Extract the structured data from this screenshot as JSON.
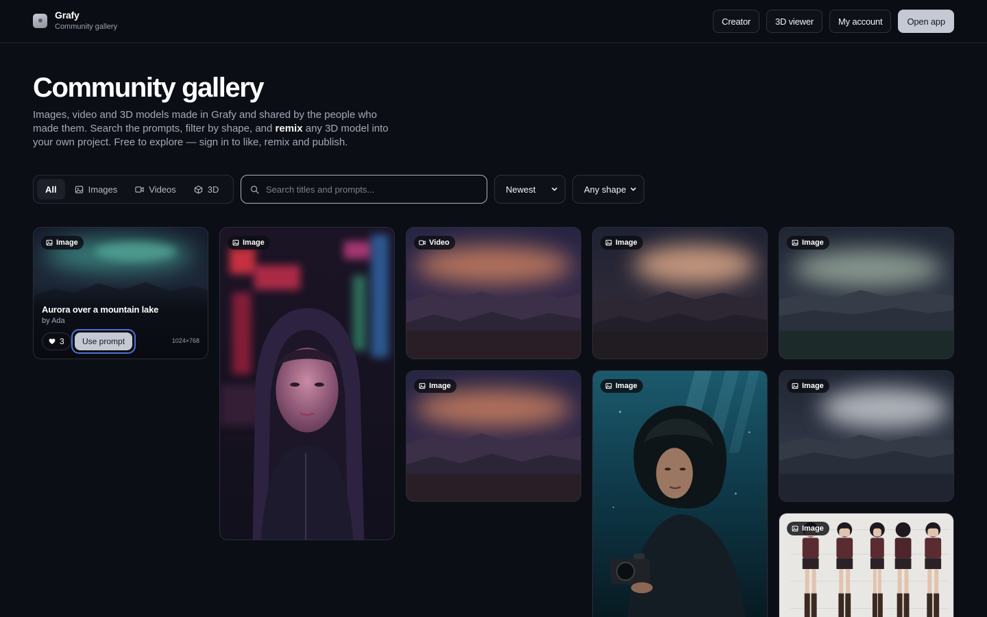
{
  "header": {
    "brand_name": "Grafy",
    "brand_sub": "Community gallery",
    "nav": [
      {
        "label": "Creator"
      },
      {
        "label": "3D viewer"
      },
      {
        "label": "My account"
      },
      {
        "label": "Open app"
      }
    ]
  },
  "hero": {
    "title": "Community gallery",
    "desc_part1": "Images, video and 3D models made in Grafy and shared by the people who made them. Search the prompts, filter by shape, and ",
    "desc_bold": "remix",
    "desc_part2": " any 3D model into your own project. Free to explore — sign in to like, remix and publish."
  },
  "filters": {
    "tabs": [
      {
        "label": "All",
        "icon": "none",
        "active": true
      },
      {
        "label": "Images",
        "icon": "image-icon",
        "active": false
      },
      {
        "label": "Videos",
        "icon": "video-icon",
        "active": false
      },
      {
        "label": "3D",
        "icon": "cube-icon",
        "active": false
      }
    ],
    "search_placeholder": "Search titles and prompts...",
    "sort": "Newest",
    "shape": "Any shape"
  },
  "cards": [
    {
      "type": "Image",
      "title": "Aurora over a mountain lake",
      "author": "by Ada",
      "likes": "3",
      "action": "Use prompt",
      "dims": "1024×768",
      "art": "aurora-teal"
    },
    {
      "type": "Image",
      "art": "neon-portrait"
    },
    {
      "type": "Video",
      "art": "aurora-orange"
    },
    {
      "type": "Image",
      "art": "aurora-peach"
    },
    {
      "type": "Image",
      "art": "aurora-sage"
    },
    {
      "type": "Image",
      "art": "aurora-orange"
    },
    {
      "type": "Image",
      "art": "underwater-portrait"
    },
    {
      "type": "Image",
      "art": "aurora-white"
    },
    {
      "type": "Image",
      "art": "character-sheet"
    }
  ],
  "colors": {
    "background": "#0c0e16",
    "accent_ring": "#5271d6",
    "primary_button": "#c5c9d3"
  }
}
